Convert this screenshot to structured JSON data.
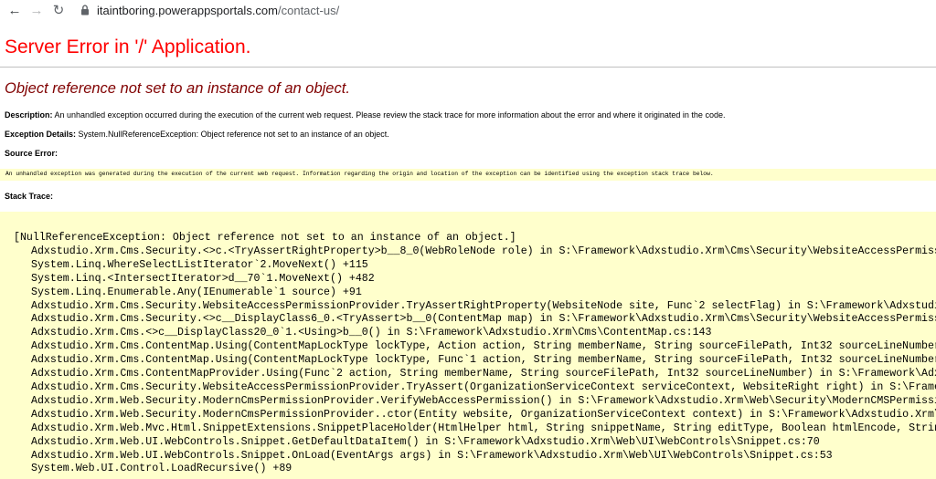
{
  "browser": {
    "url_domain": "itaintboring.powerappsportals.com",
    "url_path": "/contact-us/"
  },
  "error": {
    "title": "Server Error in '/' Application.",
    "message": "Object reference not set to an instance of an object.",
    "description_label": "Description:",
    "description_text": "An unhandled exception occurred during the execution of the current web request. Please review the stack trace for more information about the error and where it originated in the code.",
    "exception_label": "Exception Details:",
    "exception_text": "System.NullReferenceException: Object reference not set to an instance of an object.",
    "source_label": "Source Error:",
    "source_text": "An unhandled exception was generated during the execution of the current web request. Information regarding the origin and location of the exception can be identified using the exception stack trace below.",
    "stack_label": "Stack Trace:"
  },
  "stack_trace": [
    "[NullReferenceException: Object reference not set to an instance of an object.]",
    "Adxstudio.Xrm.Cms.Security.<>c.<TryAssertRightProperty>b__8_0(WebRoleNode role) in S:\\Framework\\Adxstudio.Xrm\\Cms\\Security\\WebsiteAccessPermissionPr",
    "System.Linq.WhereSelectListIterator`2.MoveNext() +115",
    "System.Linq.<IntersectIterator>d__70`1.MoveNext() +482",
    "System.Linq.Enumerable.Any(IEnumerable`1 source) +91",
    "Adxstudio.Xrm.Cms.Security.WebsiteAccessPermissionProvider.TryAssertRightProperty(WebsiteNode site, Func`2 selectFlag) in S:\\Framework\\Adxstudio.Xrm",
    "Adxstudio.Xrm.Cms.Security.<>c__DisplayClass6_0.<TryAssert>b__0(ContentMap map) in S:\\Framework\\Adxstudio.Xrm\\Cms\\Security\\WebsiteAccessPermission",
    "Adxstudio.Xrm.Cms.<>c__DisplayClass20_0`1.<Using>b__0() in S:\\Framework\\Adxstudio.Xrm\\Cms\\ContentMap.cs:143",
    "Adxstudio.Xrm.Cms.ContentMap.Using(ContentMapLockType lockType, Action action, String memberName, String sourceFilePath, Int32 sourceLineNumber) in",
    "Adxstudio.Xrm.Cms.ContentMap.Using(ContentMapLockType lockType, Func`1 action, String memberName, String sourceFilePath, Int32 sourceLineNumber) in",
    "Adxstudio.Xrm.Cms.ContentMapProvider.Using(Func`2 action, String memberName, String sourceFilePath, Int32 sourceLineNumber) in S:\\Framework\\Adxstudi",
    "Adxstudio.Xrm.Cms.Security.WebsiteAccessPermissionProvider.TryAssert(OrganizationServiceContext serviceContext, WebsiteRight right) in S:\\Framework\\",
    "Adxstudio.Xrm.Web.Security.ModernCmsPermissionProvider.VerifyWebAccessPermission() in S:\\Framework\\Adxstudio.Xrm\\Web\\Security\\ModernCMSPermissionPro",
    "Adxstudio.Xrm.Web.Security.ModernCmsPermissionProvider..ctor(Entity website, OrganizationServiceContext context) in S:\\Framework\\Adxstudio.Xrm\\Web\\S",
    "Adxstudio.Xrm.Web.Mvc.Html.SnippetExtensions.SnippetPlaceHolder(HtmlHelper html, String snippetName, String editType, Boolean htmlEncode, String tag",
    "Adxstudio.Xrm.Web.UI.WebControls.Snippet.GetDefaultDataItem() in S:\\Framework\\Adxstudio.Xrm\\Web\\UI\\WebControls\\Snippet.cs:70",
    "Adxstudio.Xrm.Web.UI.WebControls.Snippet.OnLoad(EventArgs args) in S:\\Framework\\Adxstudio.Xrm\\Web\\UI\\WebControls\\Snippet.cs:53",
    "System.Web.UI.Control.LoadRecursive() +89"
  ],
  "icons": {
    "back": "←",
    "forward": "→",
    "reload": "↻"
  }
}
